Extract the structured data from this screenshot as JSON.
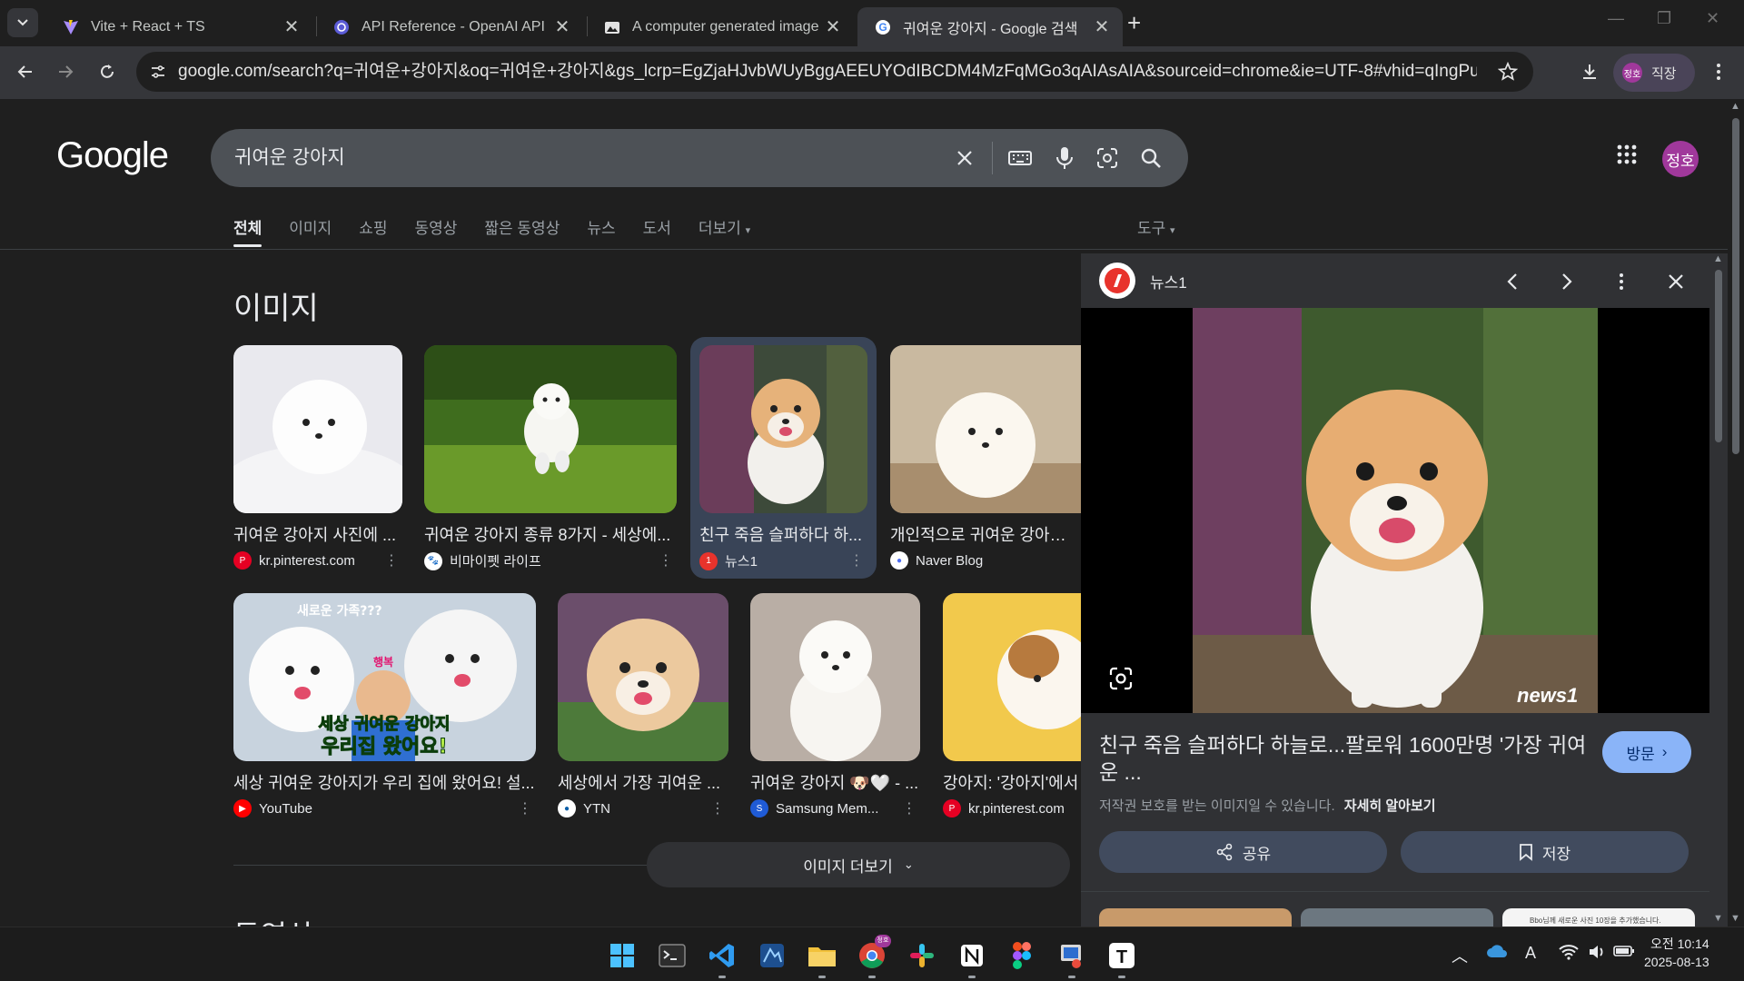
{
  "browser": {
    "tabs": [
      {
        "title": "Vite + React + TS",
        "favicon": "vite-icon",
        "active": false
      },
      {
        "title": "API Reference - OpenAI API",
        "favicon": "openai-icon",
        "active": false
      },
      {
        "title": "A computer generated image",
        "favicon": "image-icon",
        "active": false
      },
      {
        "title": "귀여운 강아지 - Google 검색",
        "favicon": "google-icon",
        "active": true
      }
    ],
    "url": "google.com/search?q=귀여운+강아지&oq=귀여운+강아지&gs_lcrp=EgZjaHJvbWUyBggAEEUYOdIBCDM4MzFqMGo3qAIAsAIA&sourceid=chrome&ie=UTF-8#vhid=qIngPuiqo6YCuM&...",
    "profile": {
      "avatar_text": "정호",
      "label": "직장"
    }
  },
  "search": {
    "logo": "Google",
    "query": "귀여운 강아지",
    "avatar_text": "정호"
  },
  "nav": {
    "items": [
      "전체",
      "이미지",
      "쇼핑",
      "동영상",
      "짧은 동영상",
      "뉴스",
      "도서",
      "더보기"
    ],
    "active_index": 0,
    "tools": "도구"
  },
  "images_section": {
    "title": "이미지",
    "row1": [
      {
        "caption": "귀여운 강아지 사진에 ...",
        "source": "kr.pinterest.com",
        "source_icon": "pinterest-icon"
      },
      {
        "caption": "귀여운 강아지 종류 8가지 - 세상에...",
        "source": "비마이펫 라이프",
        "source_icon": "paw-icon"
      },
      {
        "caption": "친구 죽음 슬퍼하다 하...",
        "source": "뉴스1",
        "source_icon": "news1-icon",
        "selected": true
      },
      {
        "caption": "개인적으로 귀여운 강아지 종",
        "source": "Naver Blog",
        "source_icon": "naver-icon"
      }
    ],
    "row2": [
      {
        "caption": "세상 귀여운 강아지가 우리 집에 왔어요! 설...",
        "source": "YouTube",
        "source_icon": "youtube-icon",
        "overlay_top": "새로운 가족???",
        "overlay_name": "행복",
        "overlay_line1": "세상 귀여운 강아지",
        "overlay_line2": "우리집 왔어요!"
      },
      {
        "caption": "세상에서 가장 귀여운 ...",
        "source": "YTN",
        "source_icon": "ytn-icon"
      },
      {
        "caption": "귀여운 강아지 🐶🤍 - ...",
        "source": "Samsung Mem...",
        "source_icon": "samsung-icon"
      },
      {
        "caption": "강아지: '강아지'에서",
        "source": "kr.pinterest.com",
        "source_icon": "pinterest-icon"
      }
    ],
    "more_button": "이미지 더보기",
    "next_section": "동영상"
  },
  "preview": {
    "source_name": "뉴스1",
    "watermark": "news1",
    "title": "친구 죽음 슬퍼하다 하늘로...팔로워 1600만명 '가장 귀여운 ...",
    "visit_label": "방문",
    "copyright": "저작권 보호를 받는 이미지일 수 있습니다.",
    "learn_more": "자세히 알아보기",
    "share_label": "공유",
    "save_label": "저장",
    "related_snippet": "Bbo님께 새로운 사진 10장을 추가했습니다."
  },
  "taskbar": {
    "apps": [
      "windows-start-icon",
      "terminal-icon",
      "vscode-icon",
      "app-icon",
      "file-explorer-icon",
      "chrome-icon",
      "slack-icon",
      "notion-icon",
      "figma-icon",
      "snipping-tool-icon",
      "typora-icon"
    ],
    "chrome_badge": "정호",
    "ime": "A",
    "time": "오전 10:14",
    "date": "2025-08-13"
  },
  "colors": {
    "bg": "#1f1f1f",
    "tab_active": "#35363a",
    "selected_card": "#394457",
    "visit_button": "#8ab4f8",
    "avatar": "#a0389b"
  }
}
